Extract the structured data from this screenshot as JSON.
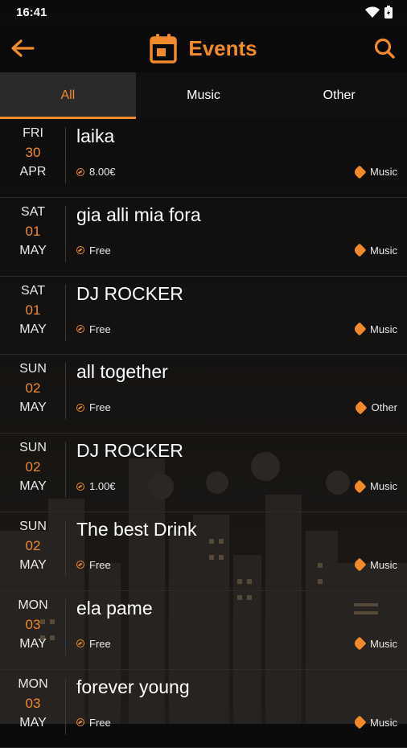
{
  "status": {
    "time": "16:41"
  },
  "appbar": {
    "title": "Events"
  },
  "tabs": [
    {
      "label": "All",
      "active": true
    },
    {
      "label": "Music",
      "active": false
    },
    {
      "label": "Other",
      "active": false
    }
  ],
  "events": [
    {
      "dow": "FRI",
      "day": "30",
      "month": "APR",
      "title": "laika",
      "price": "8.00€",
      "category": "Music"
    },
    {
      "dow": "SAT",
      "day": "01",
      "month": "MAY",
      "title": "gia alli mia fora",
      "price": "Free",
      "category": "Music"
    },
    {
      "dow": "SAT",
      "day": "01",
      "month": "MAY",
      "title": "DJ ROCKER",
      "price": "Free",
      "category": "Music"
    },
    {
      "dow": "SUN",
      "day": "02",
      "month": "MAY",
      "title": "all together",
      "price": "Free",
      "category": "Other"
    },
    {
      "dow": "SUN",
      "day": "02",
      "month": "MAY",
      "title": "DJ ROCKER",
      "price": "1.00€",
      "category": "Music"
    },
    {
      "dow": "SUN",
      "day": "02",
      "month": "MAY",
      "title": "The best Drink",
      "price": "Free",
      "category": "Music"
    },
    {
      "dow": "MON",
      "day": "03",
      "month": "MAY",
      "title": "ela pame",
      "price": "Free",
      "category": "Music"
    },
    {
      "dow": "MON",
      "day": "03",
      "month": "MAY",
      "title": "forever young",
      "price": "Free",
      "category": "Music"
    }
  ],
  "colors": {
    "accent": "#f08a2a",
    "background": "#0b0b0b"
  },
  "icons": {
    "back": "arrow-left-icon",
    "calendar": "calendar-icon",
    "search": "search-icon",
    "price": "price-icon",
    "category": "tag-icon"
  }
}
